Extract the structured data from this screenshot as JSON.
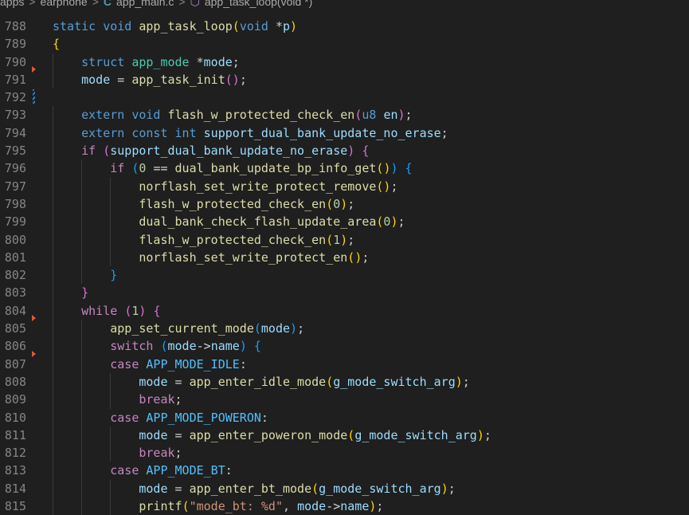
{
  "breadcrumb": {
    "items": [
      "apps",
      "earphone",
      "app_main.c",
      "app_task_loop(void *)"
    ]
  },
  "lines": [
    {
      "n": "788",
      "t": "static void app_task_loop(void *p)"
    },
    {
      "n": "789",
      "t": "{"
    },
    {
      "n": "790",
      "t": "    struct app_mode *mode;"
    },
    {
      "n": "791",
      "t": "    mode = app_task_init();"
    },
    {
      "n": "792",
      "t": ""
    },
    {
      "n": "793",
      "t": "    extern void flash_w_protected_check_en(u8 en);"
    },
    {
      "n": "794",
      "t": "    extern const int support_dual_bank_update_no_erase;"
    },
    {
      "n": "795",
      "t": "    if (support_dual_bank_update_no_erase) {"
    },
    {
      "n": "796",
      "t": "        if (0 == dual_bank_update_bp_info_get()) {"
    },
    {
      "n": "797",
      "t": "            norflash_set_write_protect_remove();"
    },
    {
      "n": "798",
      "t": "            flash_w_protected_check_en(0);"
    },
    {
      "n": "799",
      "t": "            dual_bank_check_flash_update_area(0);"
    },
    {
      "n": "800",
      "t": "            flash_w_protected_check_en(1);"
    },
    {
      "n": "801",
      "t": "            norflash_set_write_protect_en();"
    },
    {
      "n": "802",
      "t": "        }"
    },
    {
      "n": "803",
      "t": "    }"
    },
    {
      "n": "804",
      "t": "    while (1) {"
    },
    {
      "n": "805",
      "t": "        app_set_current_mode(mode);"
    },
    {
      "n": "806",
      "t": "        switch (mode->name) {"
    },
    {
      "n": "807",
      "t": "        case APP_MODE_IDLE:"
    },
    {
      "n": "808",
      "t": "            mode = app_enter_idle_mode(g_mode_switch_arg);"
    },
    {
      "n": "809",
      "t": "            break;"
    },
    {
      "n": "810",
      "t": "        case APP_MODE_POWERON:"
    },
    {
      "n": "811",
      "t": "            mode = app_enter_poweron_mode(g_mode_switch_arg);"
    },
    {
      "n": "812",
      "t": "            break;"
    },
    {
      "n": "813",
      "t": "        case APP_MODE_BT:"
    },
    {
      "n": "814",
      "t": "            mode = app_enter_bt_mode(g_mode_switch_arg);"
    },
    {
      "n": "815",
      "t": "            printf(\"mode_bt: %d\", mode->name);"
    }
  ],
  "colors": {
    "background": "#1f1f1f",
    "keyword": "#569cd6",
    "control": "#c586c0",
    "function": "#dcdcaa",
    "type": "#4ec9b0",
    "variable": "#9cdcfe",
    "number": "#b5cea8",
    "constant": "#4fc1ff",
    "line_number": "#858585"
  },
  "icons": {
    "file_icon": "c-file-icon",
    "symbol_icon": "method-cube-icon",
    "separator": "chevron-right-icon"
  }
}
